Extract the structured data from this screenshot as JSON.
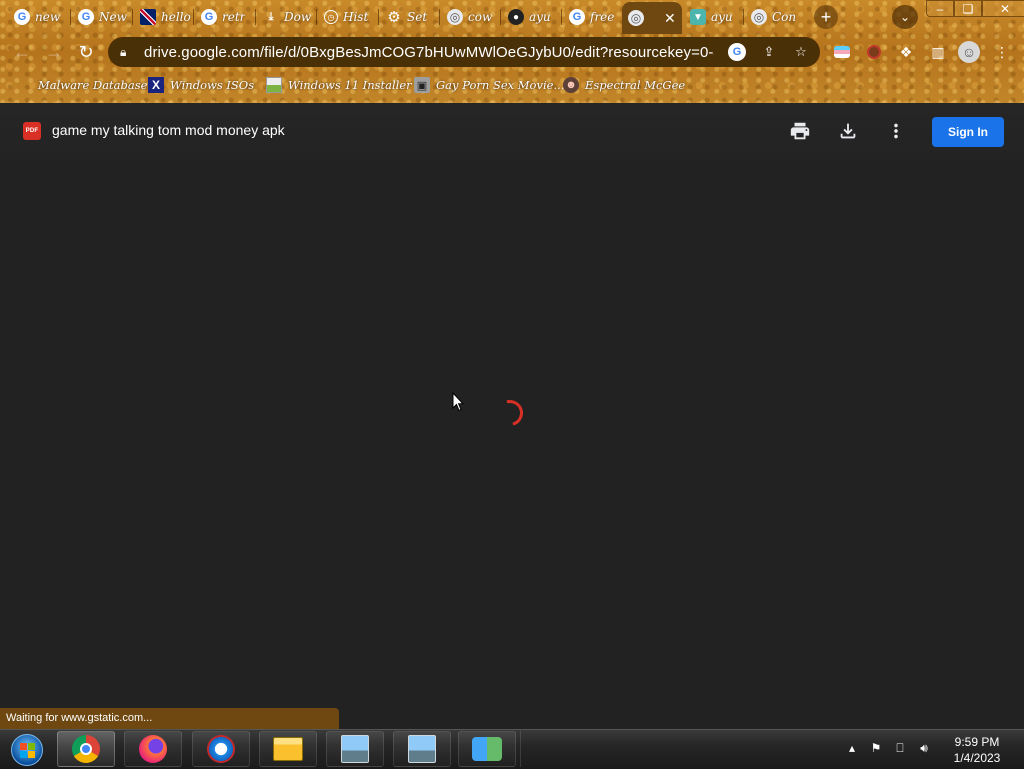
{
  "browser": {
    "tabs": [
      {
        "title": "new",
        "favicon": "google-icon"
      },
      {
        "title": "New",
        "favicon": "google-icon"
      },
      {
        "title": "hello",
        "favicon": "uk-flag-icon"
      },
      {
        "title": "retr",
        "favicon": "google-icon"
      },
      {
        "title": "Dow",
        "favicon": "download-icon"
      },
      {
        "title": "Hist",
        "favicon": "history-icon"
      },
      {
        "title": "Set",
        "favicon": "gear-icon"
      },
      {
        "title": "cow",
        "favicon": "globe-icon"
      },
      {
        "title": "ayu",
        "favicon": "github-icon"
      },
      {
        "title": "free",
        "favicon": "google-icon"
      },
      {
        "title": "",
        "favicon": "globe-icon",
        "active": true
      },
      {
        "title": "ayu",
        "favicon": "shield-icon"
      },
      {
        "title": "Con",
        "favicon": "globe-icon"
      }
    ],
    "new_tab_label": "+",
    "url": "drive.google.com/file/d/0BxgBesJmCOG7bHUwMWlOeGJybU0/edit?resourcekey=0-J...",
    "bookmarks": [
      {
        "label": "Malware Database",
        "icon": "folder-icon"
      },
      {
        "label": "Windows ISOs",
        "icon": "x-logo-icon"
      },
      {
        "label": "Windows 11 Installer",
        "icon": "image-icon"
      },
      {
        "label": "Gay Porn Sex Movie...",
        "icon": "site-icon"
      },
      {
        "label": "Espectral McGee",
        "icon": "avatar-icon"
      }
    ],
    "status_text": "Waiting for www.gstatic.com..."
  },
  "viewer": {
    "file_badge": "PDF",
    "file_title": "game my talking tom mod money apk",
    "sign_in_label": "Sign In",
    "icons": [
      "print-icon",
      "download-icon",
      "more-vert-icon"
    ]
  },
  "taskbar": {
    "time": "9:59 PM",
    "date": "1/4/2023",
    "items": [
      "start-orb-icon",
      "chrome-icon",
      "firefox-icon",
      "opera-icon",
      "file-explorer-icon",
      "network-setup-icon",
      "network-setup-icon",
      "users-icon"
    ]
  },
  "colors": {
    "signin_blue": "#1a73e8",
    "spinner_red": "#d93025",
    "pdf_red": "#d93025",
    "chrome_theme": "#c98a2a"
  }
}
